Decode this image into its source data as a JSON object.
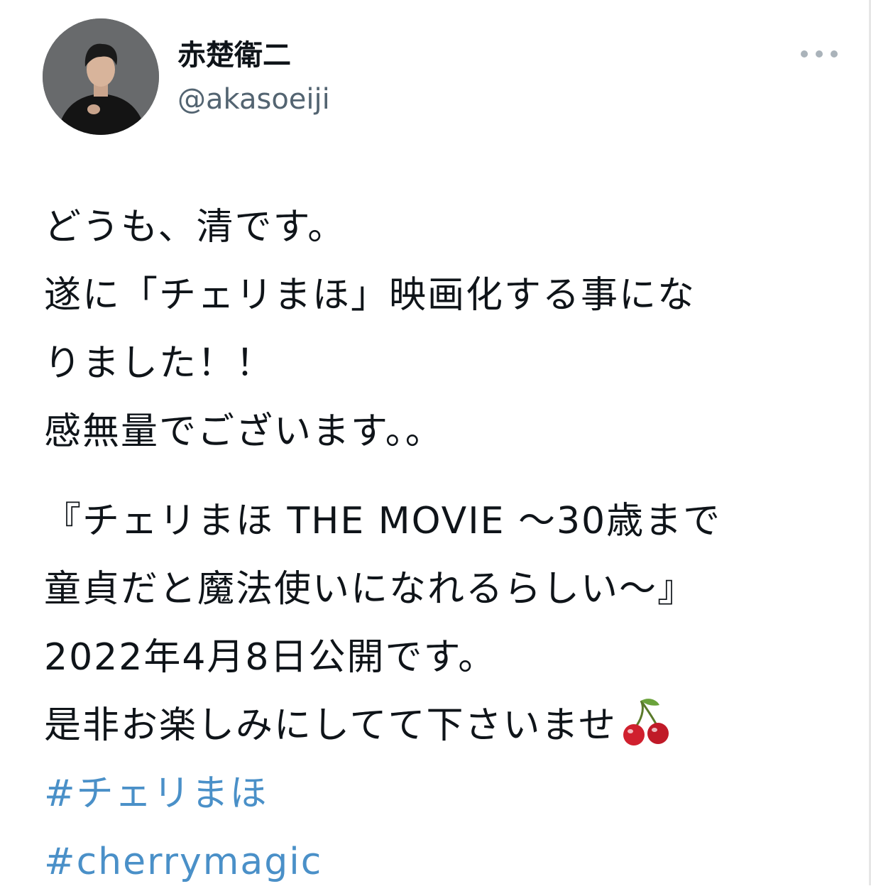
{
  "user": {
    "display_name": "赤楚衛二",
    "handle": "@akasoeiji",
    "avatar_icon": "profile-photo",
    "more_icon": "more-horizontal-icon"
  },
  "tweet": {
    "lines": [
      "どうも、清です。",
      "遂に「チェリまほ」映画化する事にな",
      "りました！！",
      "感無量でございます。。",
      "『チェリまほ THE MOVIE 〜30歳まで",
      "童貞だと魔法使いになれるらしい〜』",
      "2022年4月8日公開です。",
      "是非お楽しみにしてて下さいませ"
    ],
    "emoji": "cherries-icon",
    "hashtags": [
      "#チェリまほ",
      "#cherrymagic"
    ]
  },
  "colors": {
    "text": "#0f1419",
    "muted": "#536471",
    "link": "#4a90c8",
    "cherry": "#d0202e"
  }
}
